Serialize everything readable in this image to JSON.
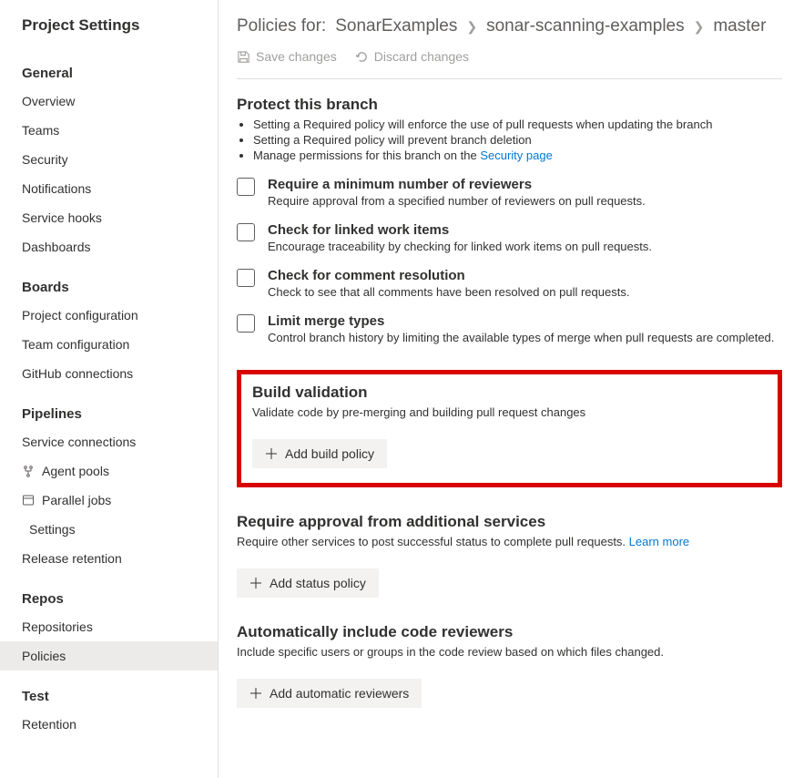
{
  "sidebar": {
    "title": "Project Settings",
    "groups": [
      {
        "title": "General",
        "items": [
          {
            "label": "Overview"
          },
          {
            "label": "Teams"
          },
          {
            "label": "Security"
          },
          {
            "label": "Notifications"
          },
          {
            "label": "Service hooks"
          },
          {
            "label": "Dashboards"
          }
        ]
      },
      {
        "title": "Boards",
        "items": [
          {
            "label": "Project configuration"
          },
          {
            "label": "Team configuration"
          },
          {
            "label": "GitHub connections"
          }
        ]
      },
      {
        "title": "Pipelines",
        "items": [
          {
            "label": "Service connections"
          },
          {
            "label": "Agent pools",
            "icon": "agent-pools-icon"
          },
          {
            "label": "Parallel jobs",
            "icon": "window-icon"
          },
          {
            "label": "Settings",
            "indent": true
          },
          {
            "label": "Release retention"
          }
        ]
      },
      {
        "title": "Repos",
        "items": [
          {
            "label": "Repositories"
          },
          {
            "label": "Policies",
            "selected": true
          }
        ]
      },
      {
        "title": "Test",
        "items": [
          {
            "label": "Retention"
          }
        ]
      }
    ]
  },
  "breadcrumb": {
    "label": "Policies for:",
    "items": [
      "SonarExamples",
      "sonar-scanning-examples",
      "master"
    ]
  },
  "toolbar": {
    "save": "Save changes",
    "discard": "Discard changes"
  },
  "protect": {
    "title": "Protect this branch",
    "b1": "Setting a Required policy will enforce the use of pull requests when updating the branch",
    "b2": "Setting a Required policy will prevent branch deletion",
    "b3_pre": "Manage permissions for this branch on the ",
    "b3_link": "Security page"
  },
  "p1": {
    "title": "Require a minimum number of reviewers",
    "desc": "Require approval from a specified number of reviewers on pull requests."
  },
  "p2": {
    "title": "Check for linked work items",
    "desc": "Encourage traceability by checking for linked work items on pull requests."
  },
  "p3": {
    "title": "Check for comment resolution",
    "desc": "Check to see that all comments have been resolved on pull requests."
  },
  "p4": {
    "title": "Limit merge types",
    "desc": "Control branch history by limiting the available types of merge when pull requests are completed."
  },
  "build": {
    "title": "Build validation",
    "desc": "Validate code by pre-merging and building pull request changes",
    "button": "Add build policy"
  },
  "services": {
    "title": "Require approval from additional services",
    "desc_pre": "Require other services to post successful status to complete pull requests.  ",
    "learn": "Learn more",
    "button": "Add status policy"
  },
  "reviewers": {
    "title": "Automatically include code reviewers",
    "desc": "Include specific users or groups in the code review based on which files changed.",
    "button": "Add automatic reviewers"
  }
}
